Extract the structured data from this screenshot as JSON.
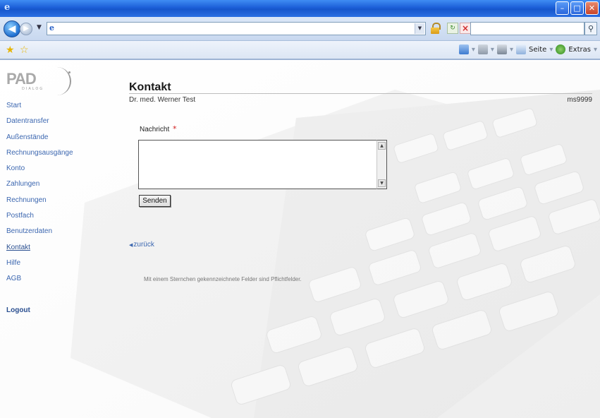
{
  "browser": {
    "search_placeholder": "",
    "address_value": "",
    "command_bar": {
      "page_label": "Seite",
      "tools_label": "Extras"
    }
  },
  "sidebar": {
    "logo_text": "PAD",
    "logo_sub": "DIALOG",
    "items": [
      {
        "label": "Start"
      },
      {
        "label": "Datentransfer"
      },
      {
        "label": "Außenstände"
      },
      {
        "label": "Rechnungsausgänge"
      },
      {
        "label": "Konto"
      },
      {
        "label": "Zahlungen"
      },
      {
        "label": "Rechnungen"
      },
      {
        "label": "Postfach"
      },
      {
        "label": "Benutzerdaten"
      },
      {
        "label": "Kontakt"
      },
      {
        "label": "Hilfe"
      },
      {
        "label": "AGB"
      }
    ],
    "logout_label": "Logout"
  },
  "main": {
    "title": "Kontakt",
    "doctor_name": "Dr. med. Werner Test",
    "user_id": "ms9999",
    "form": {
      "message_label": "Nachricht",
      "required_marker": "*",
      "message_value": "",
      "send_label": "Senden"
    },
    "back_link": "zurück",
    "footnote": "Mit einem Sternchen gekennzeichnete Felder sind Pflichtfelder."
  },
  "colors": {
    "link": "#3c67b0",
    "required": "#d11d1d",
    "titlebar": "#1c5fd8"
  }
}
